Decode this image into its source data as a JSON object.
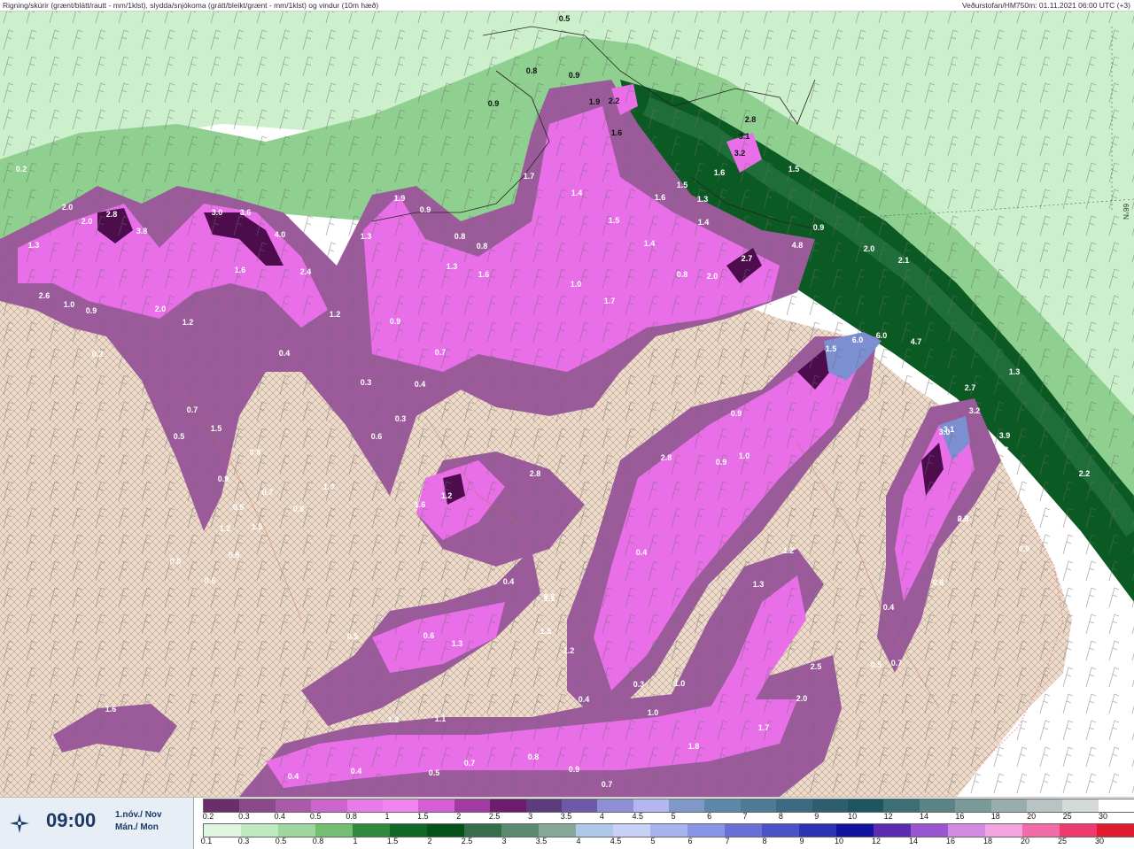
{
  "header": {
    "title": "Rigning/skúrir (grænt/blátt/rautt - mm/1klst), slydda/snjókoma (grátt/bleikt/grænt - mm/1klst) og vindur (10m hæð)",
    "source": "Veðurstofan/HM750m: 01.11.2021 06:00 UTC (+3)"
  },
  "clock": {
    "icon": "compass-star-icon",
    "time": "09:00",
    "date_line1": "1.nóv./ Nov",
    "date_line2": "Mán./ Mon"
  },
  "legend": {
    "snow_scale_labels": [
      "0.2",
      "0.3",
      "0.4",
      "0.5",
      "0.8",
      "1",
      "1.5",
      "2",
      "2.5",
      "3",
      "3.5",
      "4",
      "4.5",
      "5",
      "6",
      "7",
      "8",
      "9",
      "10",
      "12",
      "14",
      "16",
      "18",
      "20",
      "25",
      "30"
    ],
    "snow_scale_colors": [
      "#6a2f6a",
      "#8a4a8a",
      "#a95aa9",
      "#cc66cc",
      "#e97ae9",
      "#f085f0",
      "#d65fd6",
      "#a13aa1",
      "#6d1b6d",
      "#5d3c7d",
      "#6e58a8",
      "#8f8fd6",
      "#b5b5ef",
      "#7f98c7",
      "#5e88a8",
      "#4e7a96",
      "#3a6b83",
      "#2c5e6e",
      "#1d5560",
      "#3c6f74",
      "#5c8484",
      "#7a9a9a",
      "#98aeae",
      "#b8c4c4",
      "#d4dada",
      "#ffffff"
    ],
    "rain_scale_labels": [
      "0.1",
      "0.3",
      "0.5",
      "0.8",
      "1",
      "1.5",
      "2",
      "2.5",
      "3",
      "3.5",
      "4",
      "4.5",
      "5",
      "6",
      "7",
      "8",
      "9",
      "10",
      "12",
      "14",
      "16",
      "18",
      "20",
      "25",
      "30"
    ],
    "rain_scale_colors": [
      "#dff7df",
      "#bfe9bf",
      "#9ed79e",
      "#72bf72",
      "#2e8b3e",
      "#0f6a25",
      "#035218",
      "#356e4a",
      "#5c8a70",
      "#86a898",
      "#b0c8e8",
      "#c8d2f6",
      "#a8b4f0",
      "#8894e6",
      "#6870d8",
      "#4b52c8",
      "#2c33b6",
      "#1212a0",
      "#5a2ab0",
      "#9a55d0",
      "#d38ae3",
      "#f2a3e0",
      "#f26aa8",
      "#ee3a6e",
      "#e01a2c"
    ],
    "colors": {
      "land": "#efdccb",
      "snow_light": "#9b5b9b",
      "snow_mid": "#e96fe9",
      "snow_dark": "#4d0d4d",
      "rain_light": "#ccf0cc",
      "rain_mid": "#8fcf8f",
      "rain_dark": "#0c5a23",
      "sea": "#ffffff"
    }
  },
  "map_labels": [
    "0.5",
    "0.8",
    "0.9",
    "2.2",
    "1.9",
    "0.9",
    "2.8",
    "3.1",
    "3.2",
    "1.5",
    "1.5",
    "1.6",
    "1.3",
    "1.7",
    "1.4",
    "1.6",
    "1.5",
    "1.4",
    "1.4",
    "1.9",
    "0.9",
    "0.8",
    "0.8",
    "1.6",
    "4.8",
    "0.9",
    "2.7",
    "2.0",
    "2.0",
    "2.1",
    "1.0",
    "0.8",
    "1.7",
    "1.3",
    "1.6",
    "0.2",
    "2.0",
    "2.0",
    "2.8",
    "3.8",
    "1.3",
    "1.0",
    "2.6",
    "0.9",
    "2.0",
    "1.2",
    "3.0",
    "3.6",
    "4.0",
    "1.6",
    "2.4",
    "1.2",
    "0.4",
    "1.3",
    "0.9",
    "0.7",
    "0.4",
    "0.3",
    "0.3",
    "0.6",
    "0.2",
    "0.5",
    "2.8",
    "0.9",
    "1.0",
    "0.9",
    "1.5",
    "6.0",
    "6.0",
    "4.7",
    "1.3",
    "2.7",
    "3.2",
    "3.1",
    "3.0",
    "3.9",
    "3.3",
    "2.2",
    "2.8",
    "0.9",
    "0.5",
    "0.8",
    "0.4",
    "0.7",
    "0.5",
    "0.4",
    "1.6",
    "1.2",
    "2.8",
    "0.4",
    "1.1",
    "1.5",
    "0.6",
    "1.3",
    "1.2",
    "0.5",
    "0.4",
    "0.3",
    "1.0",
    "1.0",
    "1.3",
    "1.2",
    "2.5",
    "2.0",
    "1.7",
    "1.8",
    "1.2",
    "1.1",
    "0.8",
    "0.9",
    "0.7",
    "0.5",
    "0.7",
    "0.4",
    "0.4",
    "1.6",
    "0.5",
    "0.8",
    "0.7",
    "1.5",
    "1.0",
    "0.9",
    "0.6",
    "0.5",
    "0.8",
    "1.2",
    "1.5",
    "0.9",
    "0.7",
    "0.3"
  ],
  "lat_label": "66°N"
}
